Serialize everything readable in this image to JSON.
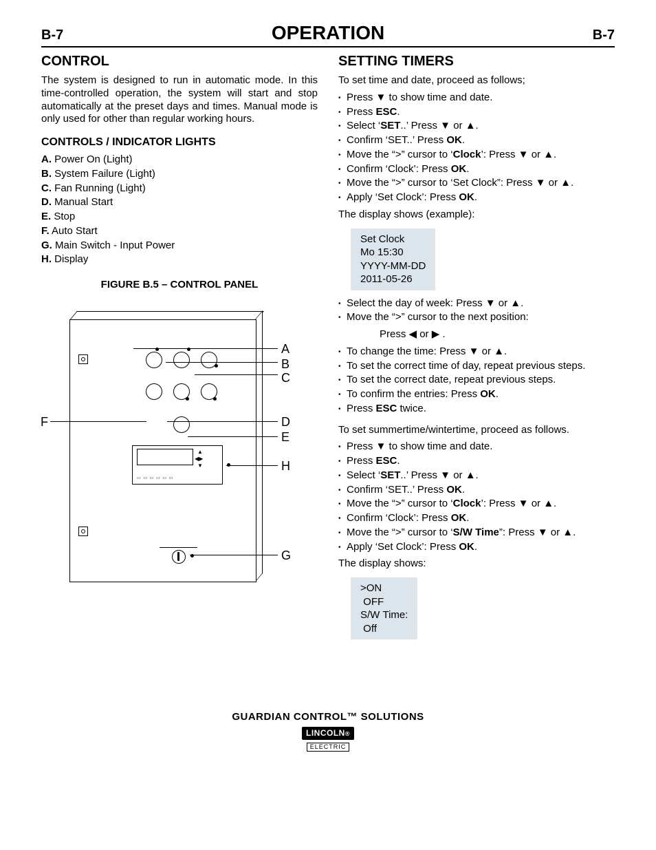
{
  "page": {
    "left": "B-7",
    "title": "OPERATION",
    "right": "B-7"
  },
  "left": {
    "h_control": "CONTROL",
    "p_control": "The system is designed to run in automatic mode. In this time-controlled operation, the system will start and stop automatically at the preset days and times. Manual mode is only used for other than regular working hours.",
    "h_ctrls": "CONTROLS / INDICATOR LIGHTS",
    "ctrls": [
      {
        "k": "A.",
        "t": "Power On (Light)"
      },
      {
        "k": "B.",
        "t": "System Failure (Light)"
      },
      {
        "k": "C.",
        "t": "Fan Running (Light)"
      },
      {
        "k": "D.",
        "t": "Manual Start"
      },
      {
        "k": "E.",
        "t": "Stop"
      },
      {
        "k": "F.",
        "t": "Auto Start"
      },
      {
        "k": "G.",
        "t": "Main Switch - Input Power"
      },
      {
        "k": "H.",
        "t": "Display"
      }
    ],
    "fig_caption": "FIGURE B.5 – CONTROL PANEL",
    "fig_labels": {
      "A": "A",
      "B": "B",
      "C": "C",
      "D": "D",
      "E": "E",
      "F": "F",
      "G": "G",
      "H": "H"
    }
  },
  "right": {
    "h_timers": "SETTING TIMERS",
    "p_intro": "To set time and date, proceed as follows;",
    "steps1": [
      "Press ▼ to show time and date.",
      "Press <b>ESC</b>.",
      "Select ‘<b>SET</b>..’ Press ▼ or ▲.",
      "Confirm ‘SET..’ Press <b>OK</b>.",
      "Move the “>” cursor to ‘<b>Clock</b>’: Press ▼ or ▲.",
      "Confirm ‘Clock’: Press <b>OK</b>.",
      "Move the “>” cursor to ‘Set Clock”: Press ▼ or ▲.",
      "Apply ‘Set Clock’: Press <b>OK</b>."
    ],
    "p_disp1": "The display shows (example):",
    "display1": [
      "Set Clock",
      "Mo 15:30",
      "YYYY-MM-DD",
      "2011-05-26"
    ],
    "steps2": [
      "Select the day of week:  Press ▼ or ▲.",
      "Move the “>” cursor to the next position:"
    ],
    "indent_line": "Press ◀ or ▶ .",
    "steps3": [
      "To change the time: Press ▼ or ▲.",
      "To set the correct time of day, repeat previous steps.",
      "To set the correct date, repeat previous steps.",
      "To confirm the entries: Press <b>OK</b>.",
      "Press <b>ESC</b> twice."
    ],
    "p_summer": "To set summertime/wintertime, proceed as follows.",
    "steps4": [
      "Press ▼ to show time and date.",
      "Press <b>ESC</b>.",
      "Select ‘<b>SET</b>..’ Press ▼ or ▲.",
      "Confirm ‘SET..’ Press <b>OK</b>.",
      "Move the “>” cursor to ‘<b>Clock</b>’: Press ▼ or ▲.",
      "Confirm ‘Clock’: Press <b>OK</b>.",
      "Move the “>” cursor to ‘<b>S/W Time</b>”: Press ▼ or ▲.",
      "Apply ‘Set Clock’: Press <b>OK</b>."
    ],
    "p_disp2": "The display shows:",
    "display2": [
      ">ON",
      " OFF",
      "S/W Time:",
      " Off"
    ]
  },
  "footer": {
    "line1": "GUARDIAN CONTROL™ SOLUTIONS",
    "logo_top": "LINCOLN",
    "logo_sub": "ELECTRIC"
  }
}
